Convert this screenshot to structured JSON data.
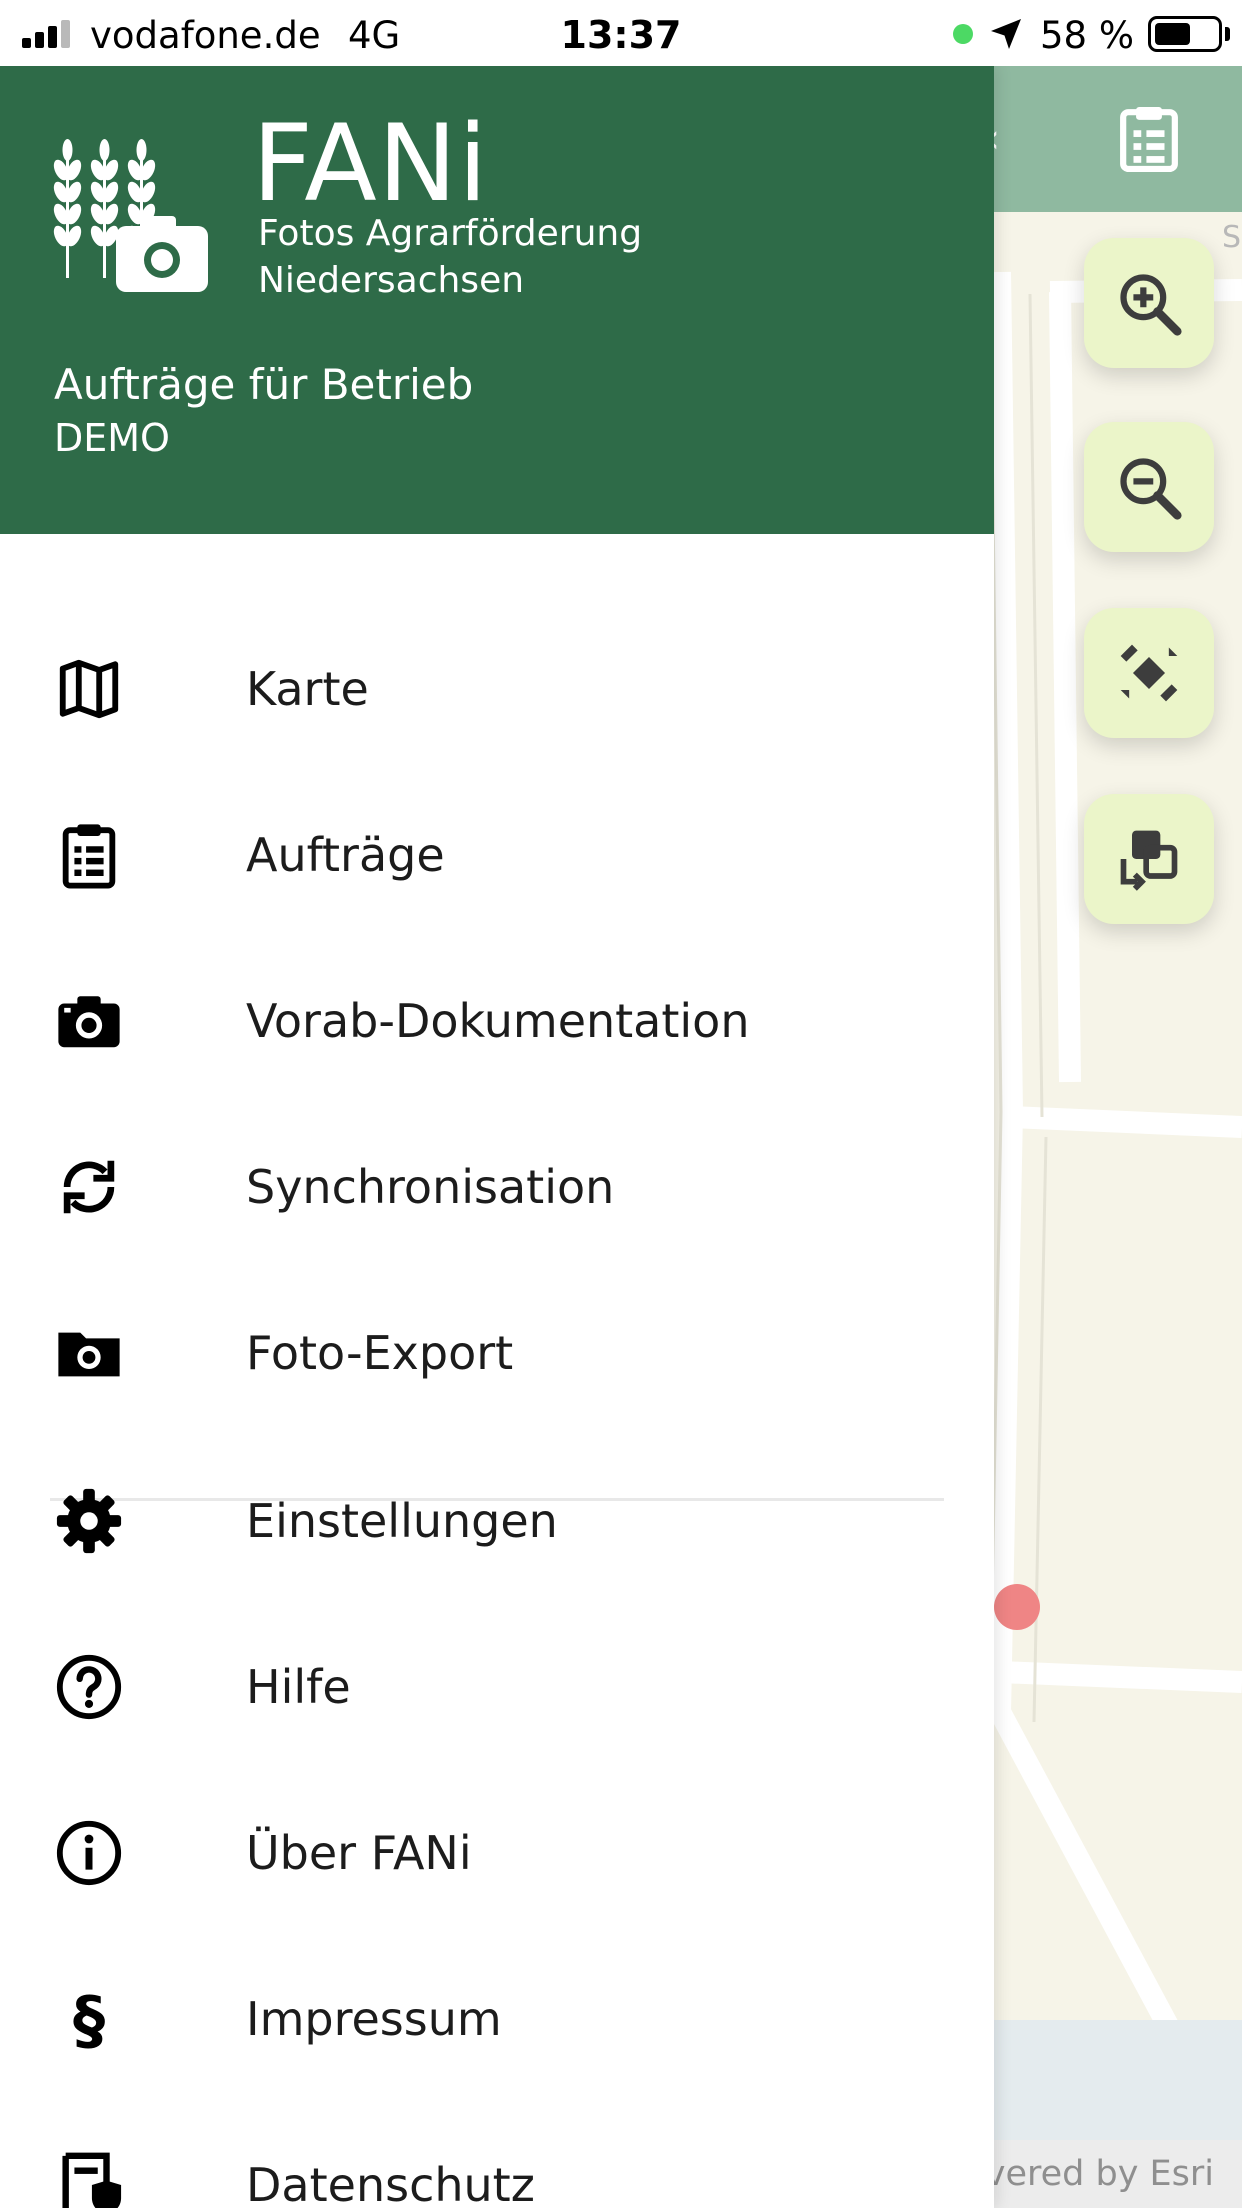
{
  "status_bar": {
    "carrier": "vodafone.de",
    "network": "4G",
    "time": "13:37",
    "battery_percent": "58 %",
    "battery_level": 0.58
  },
  "map": {
    "edge_label": "S",
    "attribution": "vered by Esri",
    "controls": [
      {
        "name": "zoom-in-button",
        "icon": "zoom-in-icon"
      },
      {
        "name": "zoom-out-button",
        "icon": "zoom-out-icon"
      },
      {
        "name": "locate-button",
        "icon": "gps-satellite-icon"
      },
      {
        "name": "switch-layer-button",
        "icon": "layer-switch-icon"
      }
    ]
  },
  "drawer": {
    "title": "FANi",
    "subtitle_line1": "Fotos Agrarförderung",
    "subtitle_line2": "Niedersachsen",
    "farm_label": "Aufträge für Betrieb",
    "farm_name": "DEMO",
    "menu": [
      {
        "label": "Karte",
        "icon": "map-icon"
      },
      {
        "label": "Aufträge",
        "icon": "clipboard-list-icon"
      },
      {
        "label": "Vorab-Dokumentation",
        "icon": "camera-icon"
      },
      {
        "label": "Synchronisation",
        "icon": "sync-icon"
      },
      {
        "label": "Foto-Export",
        "icon": "photo-folder-icon"
      },
      {
        "label": "Einstellungen",
        "icon": "gear-icon"
      },
      {
        "label": "Hilfe",
        "icon": "help-circle-icon"
      },
      {
        "label": "Über FANi",
        "icon": "info-circle-icon"
      },
      {
        "label": "Impressum",
        "icon": "paragraph-icon"
      },
      {
        "label": "Datenschutz",
        "icon": "privacy-document-icon"
      }
    ]
  },
  "colors": {
    "drawer_header": "#2e6b48",
    "map_header": "#8fb9a0",
    "map_button": "#ebf5c9",
    "map_background": "#f6f4e8",
    "marker": "#ef8585"
  }
}
